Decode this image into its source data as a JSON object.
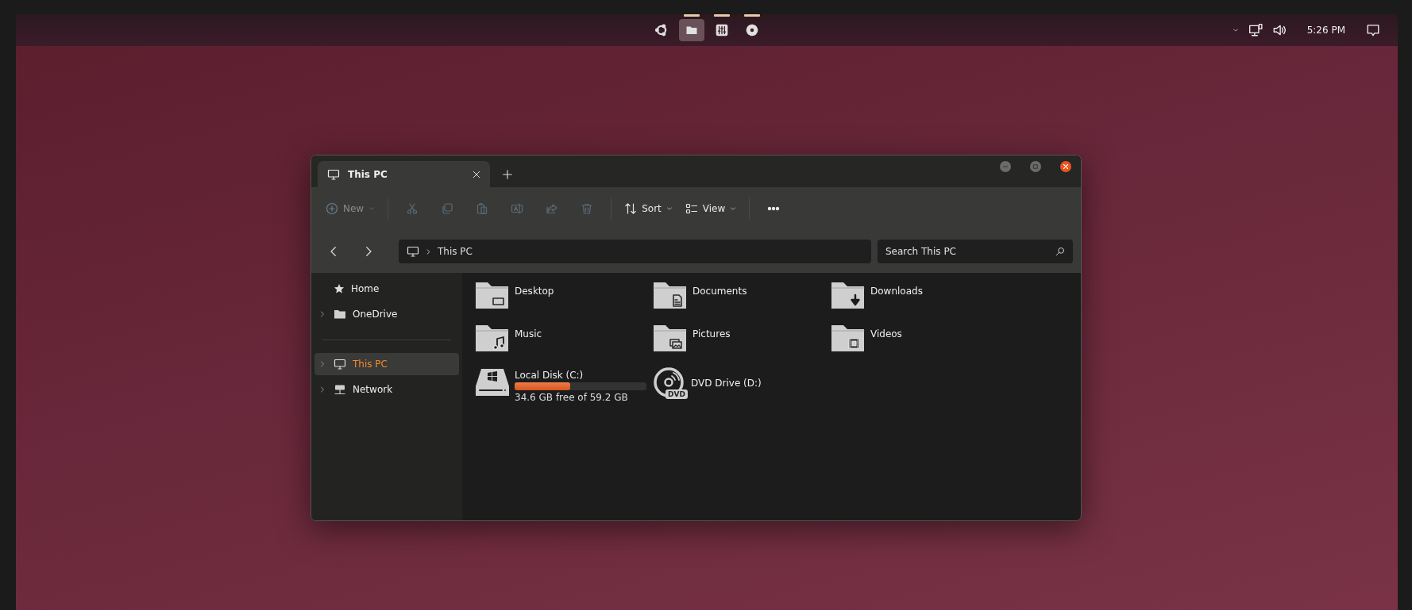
{
  "top_panel": {
    "dock": [
      {
        "selected": false,
        "running": false
      },
      {
        "selected": true,
        "running": true
      },
      {
        "selected": false,
        "running": true
      },
      {
        "selected": false,
        "running": true
      }
    ],
    "clock": "5:26 PM"
  },
  "window": {
    "tabs": [
      {
        "label": "This PC",
        "selected": true
      }
    ],
    "toolbar": [
      {
        "kind": "menu",
        "label": "New",
        "disabled": true
      },
      {
        "kind": "icon",
        "disabled": true
      },
      {
        "kind": "icon",
        "disabled": true
      },
      {
        "kind": "icon",
        "disabled": true
      },
      {
        "kind": "icon",
        "disabled": true
      },
      {
        "kind": "icon",
        "disabled": true
      },
      {
        "kind": "icon",
        "disabled": true
      },
      {
        "kind": "menu",
        "label": "Sort",
        "disabled": false
      },
      {
        "kind": "menu",
        "label": "View",
        "disabled": false
      },
      {
        "kind": "more",
        "disabled": false
      }
    ],
    "address": {
      "path": "This PC"
    },
    "search": {
      "placeholder": "Search This PC"
    },
    "sidebar": {
      "items": [
        {
          "label": "Home",
          "expandable": false,
          "selected": false
        },
        {
          "label": "OneDrive",
          "expandable": true,
          "selected": false
        },
        {
          "label": "This PC",
          "expandable": true,
          "selected": true
        },
        {
          "label": "Network",
          "expandable": true,
          "selected": false
        }
      ]
    },
    "items": [
      {
        "kind": "folder",
        "name": "Desktop"
      },
      {
        "kind": "folder",
        "name": "Documents"
      },
      {
        "kind": "folder",
        "name": "Downloads"
      },
      {
        "kind": "folder",
        "name": "Music"
      },
      {
        "kind": "folder",
        "name": "Pictures"
      },
      {
        "kind": "folder",
        "name": "Videos"
      },
      {
        "kind": "drive",
        "name": "Local Disk (C:)",
        "level": 0.42,
        "detail": "34.6 GB free of 59.2 GB"
      },
      {
        "kind": "disc",
        "name": "DVD Drive (D:)",
        "badge": "DVD"
      }
    ]
  }
}
